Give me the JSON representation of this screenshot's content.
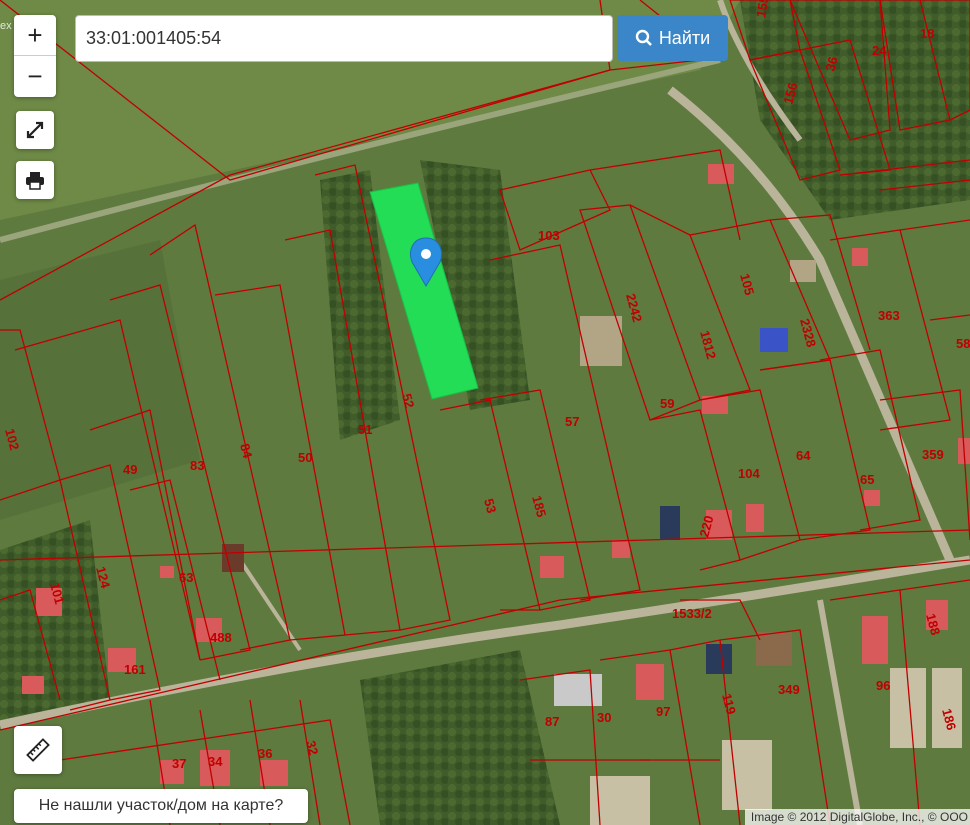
{
  "search": {
    "value": "33:01:001405:54",
    "button_label": "Найти"
  },
  "zoom": {
    "in_label": "+",
    "out_label": "−"
  },
  "buttons": {
    "fullscreen_icon": "expand-icon",
    "print_icon": "printer-icon",
    "ruler_icon": "ruler-icon"
  },
  "not_found_label": "Не нашли участок/дом на карте?",
  "copyright": "Image © 2012 DigitalGlobe, Inc., © ООО",
  "watermark": "ex",
  "colors": {
    "boundary": "#c00000",
    "selected_parcel": "#22dd55",
    "marker": "#2a8ee0",
    "search_button": "#3a86c8"
  },
  "plot_labels": [
    "155",
    "24",
    "18",
    "36",
    "156",
    "103",
    "2242",
    "105",
    "2328",
    "363",
    "58",
    "1812",
    "59",
    "57",
    "52",
    "51",
    "50",
    "84",
    "83",
    "49",
    "102",
    "185",
    "53",
    "64",
    "104",
    "65",
    "359",
    "220",
    "124",
    "63",
    "101",
    "488",
    "161",
    "1533/2",
    "188",
    "349",
    "96",
    "186",
    "119",
    "97",
    "30",
    "87",
    "37",
    "34",
    "36",
    "32"
  ]
}
